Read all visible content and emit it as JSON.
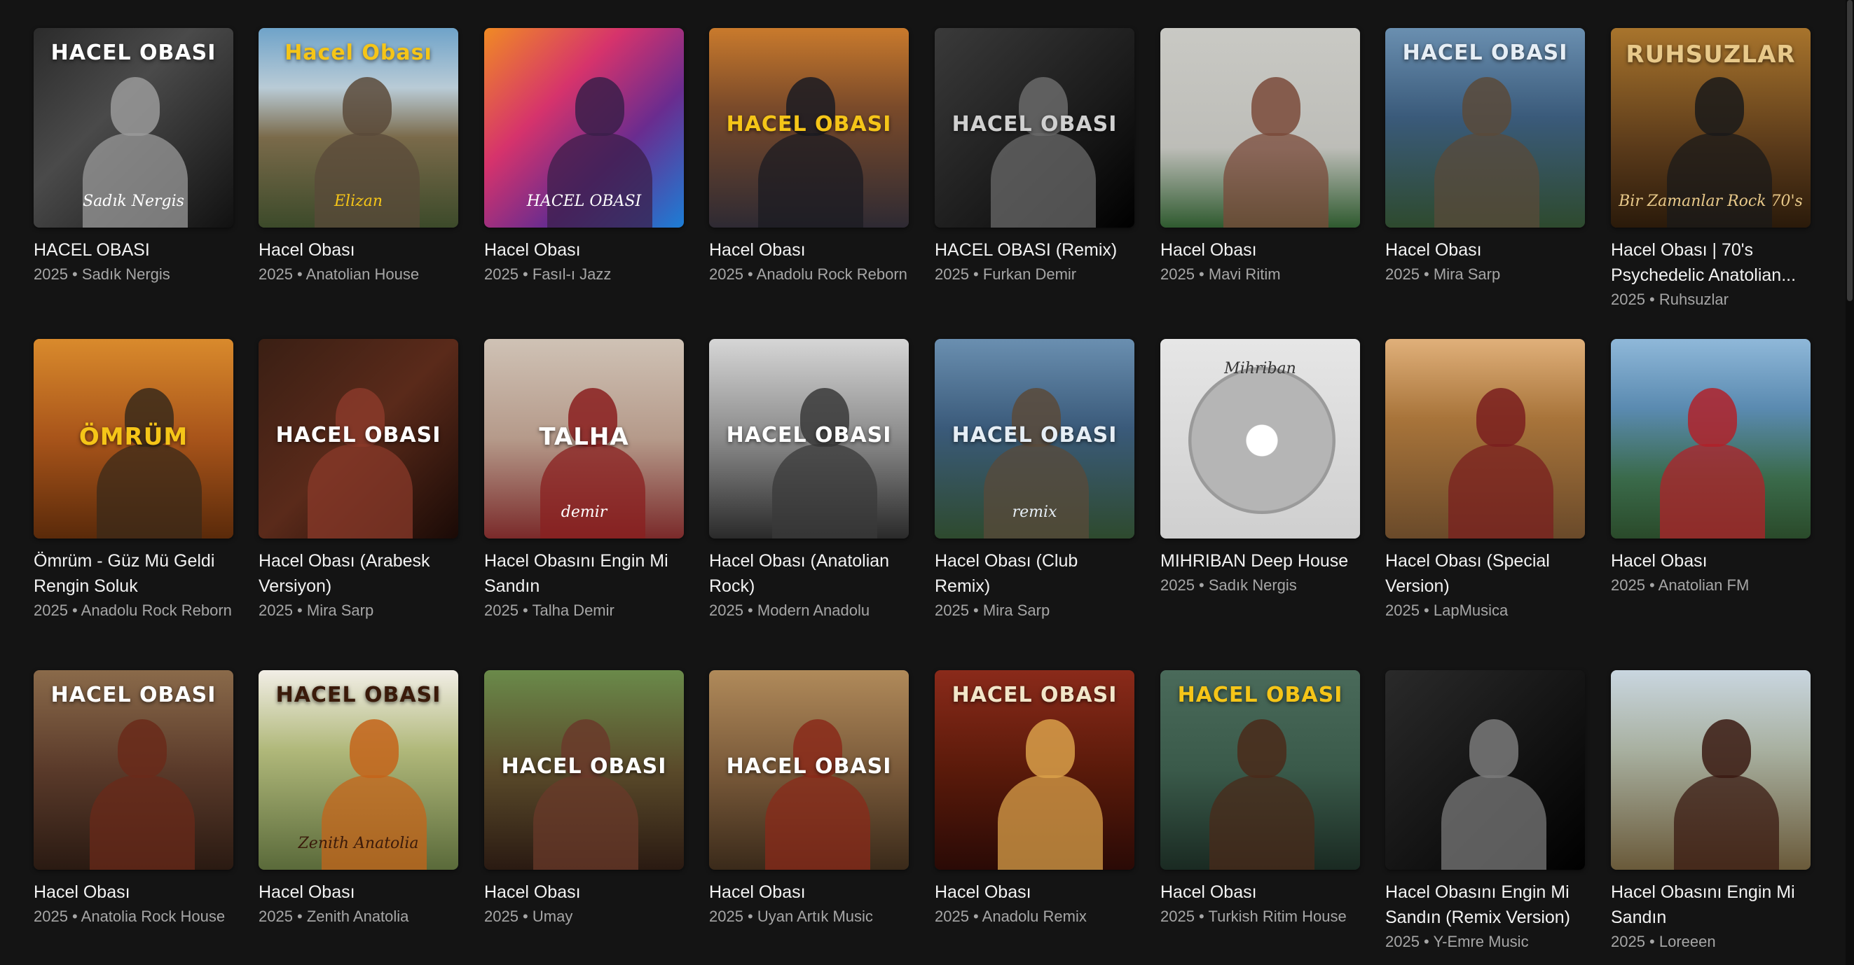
{
  "albums": [
    {
      "title": "HACEL OBASI",
      "meta": "2025 • Sadık Nergis",
      "art": {
        "bg": "linear-gradient(135deg,#2b2b2b 0%,#4a4a4a 40%,#111 100%)",
        "figure": "#9a9a9a",
        "text": "HACEL OBASI",
        "text_color": "#ffffff",
        "sub": "Sadık Nergis"
      }
    },
    {
      "title": "Hacel Obası",
      "meta": "2025 • Anatolian House",
      "art": {
        "bg": "linear-gradient(180deg,#6fa3c9 0%,#b9cbd6 30%,#7a6a4a 55%,#3c4a2a 100%)",
        "figure": "#5a4a3a",
        "text": "Hacel Obası",
        "text_color": "#f5c518",
        "sub": "Elizan"
      }
    },
    {
      "title": "Hacel Obası",
      "meta": "2025 • Fasıl-ı Jazz",
      "art": {
        "bg": "linear-gradient(135deg,#f08a24 0%,#d6336c 35%,#6a2c8f 65%,#1c7ed6 100%)",
        "figure": "#3b1f4a",
        "text": "",
        "text_color": "#ffffff",
        "sub": "HACEL OBASI"
      }
    },
    {
      "title": "Hacel Obası",
      "meta": "2025 • Anadolu Rock Reborn",
      "art": {
        "bg": "linear-gradient(180deg,#c97a2c 0%,#7a4a2a 40%,#2e2a33 100%)",
        "figure": "#1b1b22",
        "text": "HACEL OBASI",
        "text_color": "#f5c518",
        "sub": ""
      }
    },
    {
      "title": "HACEL OBASI (Remix)",
      "meta": "2025 • Furkan Demir",
      "art": {
        "bg": "linear-gradient(135deg,#3a3a3a 0%,#1a1a1a 60%,#000 100%)",
        "figure": "#6a6a6a",
        "text": "HACEL OBASI",
        "text_color": "#d0d0d0",
        "sub": ""
      }
    },
    {
      "title": "Hacel Obası",
      "meta": "2025 • Mavi Ritim",
      "art": {
        "bg": "linear-gradient(180deg,#c9c9c4 0%,#bdbdb8 60%,#2f5a2f 100%)",
        "figure": "#7a4a3a",
        "text": "",
        "text_color": "#ffffff",
        "sub": ""
      }
    },
    {
      "title": "Hacel Obası",
      "meta": "2025 • Mira Sarp",
      "art": {
        "bg": "linear-gradient(180deg,#6a8fb0 0%,#3a5a7a 45%,#2e4a2e 100%)",
        "figure": "#5a4a3a",
        "text": "HACEL OBASI",
        "text_color": "#e6eef5",
        "sub": ""
      }
    },
    {
      "title": "Hacel Obası | 70's Psychedelic Anatolian...",
      "meta": "2025 • Ruhsuzlar",
      "art": {
        "bg": "linear-gradient(180deg,#a8742c 0%,#5a3a1a 60%,#2a1a0a 100%)",
        "figure": "#1a1a1a",
        "text": "RUHSUZLAR",
        "text_color": "#e8c98a",
        "sub": "Bir Zamanlar Rock 70's"
      }
    },
    {
      "title": "Ömrüm - Güz Mü Geldi Rengin Soluk",
      "meta": "2025 • Anadolu Rock Reborn",
      "art": {
        "bg": "linear-gradient(180deg,#d98a2c 0%,#a8541a 50%,#5a2a0a 100%)",
        "figure": "#3a2a1a",
        "text": "ÖMRÜM",
        "text_color": "#f5c518",
        "sub": ""
      }
    },
    {
      "title": "Hacel Obası (Arabesk Versiyon)",
      "meta": "2025 • Mira Sarp",
      "art": {
        "bg": "linear-gradient(135deg,#3a1f14 0%,#5a2a1a 50%,#1a0a06 100%)",
        "figure": "#8a3a2a",
        "text": "HACEL OBASI",
        "text_color": "#ffffff",
        "sub": ""
      }
    },
    {
      "title": "Hacel Obasını Engin Mi Sandın",
      "meta": "2025 • Talha Demir",
      "art": {
        "bg": "linear-gradient(180deg,#cfc2b5 0%,#b59a8a 50%,#7a2a2a 100%)",
        "figure": "#8a1f1f",
        "text": "TALHA",
        "text_color": "#ffffff",
        "sub": "demir"
      }
    },
    {
      "title": "Hacel Obası (Anatolian Rock)",
      "meta": "2025 • Modern Anadolu",
      "art": {
        "bg": "linear-gradient(180deg,#d6d6d6 0%,#8a8a8a 50%,#2a2a2a 100%)",
        "figure": "#3a3a3a",
        "text": "HACEL OBASI",
        "text_color": "#ffffff",
        "sub": ""
      }
    },
    {
      "title": "Hacel Obası (Club Remix)",
      "meta": "2025 • Mira Sarp",
      "art": {
        "bg": "linear-gradient(180deg,#6a8fb0 0%,#3a5a7a 45%,#2e4a2e 100%)",
        "figure": "#5a4a3a",
        "text": "HACEL OBASI",
        "text_color": "#e6eef5",
        "sub": "remix"
      }
    },
    {
      "title": "MIHRIBAN Deep House",
      "meta": "2025 • Sadık Nergis",
      "art": {
        "bg": "linear-gradient(180deg,#e6e6e6 0%,#cfcfcf 100%)",
        "figure": "",
        "text": "",
        "text_color": "#333333",
        "sub": "Mihriban"
      }
    },
    {
      "title": "Hacel Obası (Special Version)",
      "meta": "2025 • LapMusica",
      "art": {
        "bg": "linear-gradient(180deg,#e0b07a 0%,#a8743a 40%,#6a4a2a 100%)",
        "figure": "#7a1f1f",
        "text": "",
        "text_color": "#ffffff",
        "sub": ""
      }
    },
    {
      "title": "Hacel Obası",
      "meta": "2025 • Anatolian FM",
      "art": {
        "bg": "linear-gradient(180deg,#8fb8d9 0%,#5a8ab0 35%,#3a6a4a 70%,#2a4a2a 100%)",
        "figure": "#b0222a",
        "text": "",
        "text_color": "#ffffff",
        "sub": ""
      }
    },
    {
      "title": "Hacel Obası",
      "meta": "2025 • Anatolia Rock House",
      "art": {
        "bg": "linear-gradient(180deg,#8a6a4a 0%,#5a3a2a 50%,#2a1a12 100%)",
        "figure": "#6a2a1a",
        "text": "HACEL OBASI",
        "text_color": "#ffffff",
        "sub": ""
      }
    },
    {
      "title": "Hacel Obası",
      "meta": "2025 • Zenith Anatolia",
      "art": {
        "bg": "linear-gradient(180deg,#f2eee6 0%,#b0b87a 40%,#5a6a3a 100%)",
        "figure": "#c4641a",
        "text": "HACEL OBASI",
        "text_color": "#3a1a0a",
        "sub": "Zenith Anatolia"
      }
    },
    {
      "title": "Hacel Obası",
      "meta": "2025 • Umay",
      "art": {
        "bg": "linear-gradient(180deg,#6a8a4a 0%,#5a4a2a 50%,#2a1a12 100%)",
        "figure": "#6a3a2a",
        "text": "HACEL OBASI",
        "text_color": "#ffffff",
        "sub": ""
      }
    },
    {
      "title": "Hacel Obası",
      "meta": "2025 • Uyan Artık Music",
      "art": {
        "bg": "linear-gradient(180deg,#b08a5a 0%,#7a5a3a 50%,#3a2a1a 100%)",
        "figure": "#8a2a1a",
        "text": "HACEL OBASI",
        "text_color": "#ffffff",
        "sub": ""
      }
    },
    {
      "title": "Hacel Obası",
      "meta": "2025 • Anadolu Remix",
      "art": {
        "bg": "linear-gradient(180deg,#8a2a1a 0%,#5a1a0a 50%,#2a0a06 100%)",
        "figure": "#d9a04a",
        "text": "HACEL OBASI",
        "text_color": "#f2e6c9",
        "sub": ""
      }
    },
    {
      "title": "Hacel Obası",
      "meta": "2025 • Turkish Ritim House",
      "art": {
        "bg": "linear-gradient(180deg,#4a6a5a 0%,#3a5a4a 50%,#1a2a22 100%)",
        "figure": "#4a2a1a",
        "text": "HACEL OBASI",
        "text_color": "#f5c518",
        "sub": ""
      }
    },
    {
      "title": "Hacel Obasını Engin Mi Sandın (Remix Version)",
      "meta": "2025 • Y-Emre Music",
      "art": {
        "bg": "linear-gradient(135deg,#2a2a2a 0%,#111 60%,#000 100%)",
        "figure": "#7a7a7a",
        "text": "",
        "text_color": "#ffffff",
        "sub": ""
      }
    },
    {
      "title": "Hacel Obasını Engin Mi Sandın",
      "meta": "2025 • Loreeen",
      "art": {
        "bg": "linear-gradient(180deg,#c9d6e0 0%,#a8b0a0 40%,#6a5a3a 100%)",
        "figure": "#3a1a12",
        "text": "",
        "text_color": "#ffffff",
        "sub": ""
      }
    }
  ]
}
